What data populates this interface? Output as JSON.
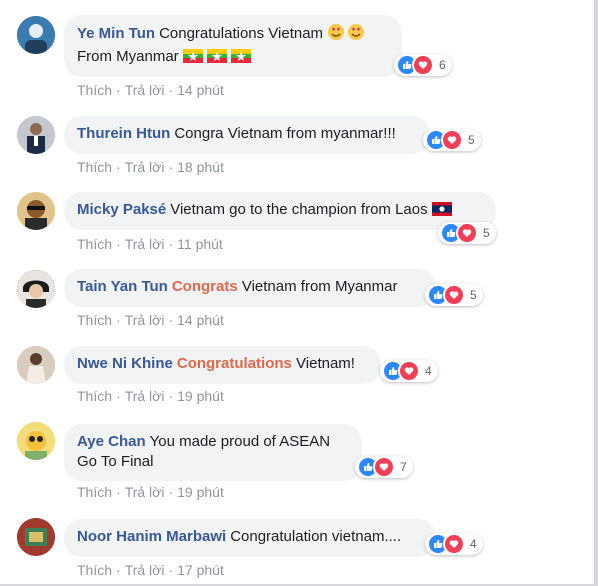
{
  "comments": [
    {
      "author": "Ye Min Tun",
      "highlight": "",
      "text": "Congratulations Vietnam",
      "line2": "From Myanmar",
      "reactions": "6",
      "time": "14 phút",
      "avatar_bg": "#2c5f8a"
    },
    {
      "author": "Thurein Htun",
      "highlight": "",
      "text": "Congra Vietnam from myanmar!!!",
      "line2": "",
      "reactions": "5",
      "time": "18 phút",
      "avatar_bg": "#9fa4ad"
    },
    {
      "author": "Micky Paksé",
      "highlight": "",
      "text": "Vietnam go to the champion from Laos",
      "line2": "",
      "reactions": "5",
      "time": "11 phút",
      "avatar_bg": "#c9a35a"
    },
    {
      "author": "Tain Yan Tun",
      "highlight": "Congrats",
      "text": "Vietnam from Myanmar",
      "line2": "",
      "reactions": "5",
      "time": "14 phút",
      "avatar_bg": "#3b2f2f"
    },
    {
      "author": "Nwe Ni Khine",
      "highlight": "Congratulations",
      "text": "Vietnam!",
      "line2": "",
      "reactions": "4",
      "time": "19 phút",
      "avatar_bg": "#b59c86"
    },
    {
      "author": "Aye Chan",
      "highlight": "",
      "text": "You made proud of ASEAN",
      "line2": "Go To Final",
      "reactions": "7",
      "time": "19 phút",
      "avatar_bg": "#e8c84a"
    },
    {
      "author": "Noor Hanim Marbawi",
      "highlight": "",
      "text": "Congratulation vietnam....",
      "line2": "",
      "reactions": "4",
      "time": "17 phút",
      "avatar_bg": "#7a2a2a"
    }
  ],
  "actions": {
    "like": "Thích",
    "reply": "Trả lời",
    "separator": "·"
  },
  "colors": {
    "author": "#385898",
    "highlight": "#e0684b",
    "bubble": "#f2f3f5",
    "like": "#2d88ff",
    "love": "#f33e58"
  }
}
